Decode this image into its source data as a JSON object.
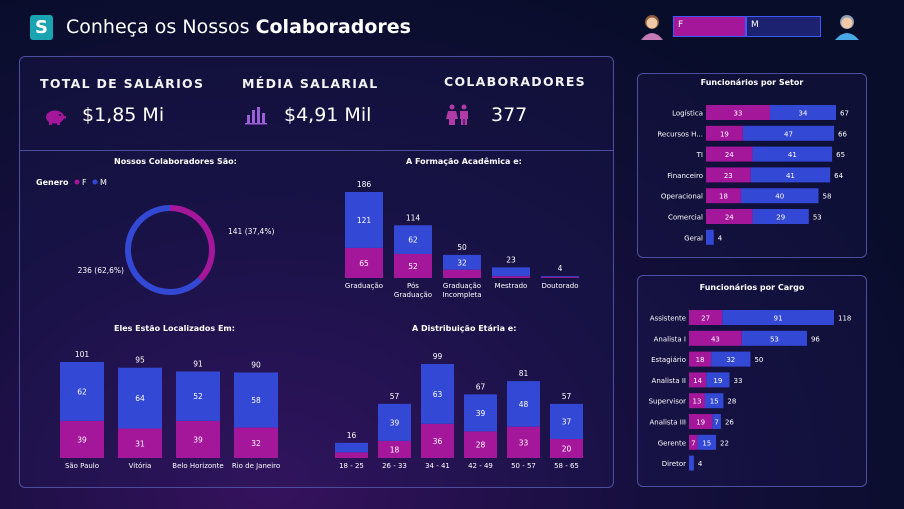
{
  "header": {
    "title_normal": "Conheça os Nossos ",
    "title_bold": "Colaboradores",
    "logo_letter": "S",
    "slicer_f": "F",
    "slicer_m": "M"
  },
  "colors": {
    "female": "#a4169a",
    "male": "#3348d4",
    "panel_border": "#4b4f9e"
  },
  "kpis": [
    {
      "label": "TOTAL DE SALÁRIOS",
      "value": "$1,85 Mi",
      "icon": "piggy-bank-icon"
    },
    {
      "label": "MÉDIA SALARIAL",
      "value": "$4,91 Mil",
      "icon": "bar-chart-icon"
    },
    {
      "label": "COLABORADORES",
      "value": "377",
      "icon": "people-icon"
    }
  ],
  "chart_data": [
    {
      "type": "pie",
      "title": "Nossos Colaboradores São:",
      "legend_title": "Genero",
      "categories": [
        "F",
        "M"
      ],
      "values": [
        141,
        236
      ],
      "labels": [
        "141 (37,4%)",
        "236 (62,6%)"
      ]
    },
    {
      "type": "bar",
      "title": "A Formação Acadêmica e:",
      "categories": [
        "Graduação",
        "Pós Graduação",
        "Graduação Incompleta",
        "Mestrado",
        "Doutorado"
      ],
      "category_lines": [
        [
          "Graduação"
        ],
        [
          "Pós",
          "Graduação"
        ],
        [
          "Graduação",
          "Incompleta"
        ],
        [
          "Mestrado"
        ],
        [
          "Doutorado"
        ]
      ],
      "series": [
        {
          "name": "F",
          "values": [
            65,
            52,
            18,
            4,
            2
          ]
        },
        {
          "name": "M",
          "values": [
            121,
            62,
            32,
            19,
            2
          ]
        }
      ],
      "totals": [
        186,
        114,
        50,
        23,
        4
      ],
      "inner_labels": {
        "F": [
          "65",
          "52",
          "",
          "",
          ""
        ],
        "M": [
          "121",
          "62",
          "32",
          "",
          ""
        ]
      }
    },
    {
      "type": "bar",
      "title": "Eles Estão Localizados Em:",
      "categories": [
        "São Paulo",
        "Vitória",
        "Belo Horizonte",
        "Rio de Janeiro"
      ],
      "series": [
        {
          "name": "F",
          "values": [
            39,
            31,
            39,
            32
          ]
        },
        {
          "name": "M",
          "values": [
            62,
            64,
            52,
            58
          ]
        }
      ],
      "totals": [
        101,
        95,
        91,
        90
      ]
    },
    {
      "type": "bar",
      "title": "A Distribuição Etária e:",
      "categories": [
        "18 - 25",
        "26 - 33",
        "34 - 41",
        "42 - 49",
        "50 - 57",
        "58 - 65"
      ],
      "series": [
        {
          "name": "F",
          "values": [
            6,
            18,
            36,
            28,
            33,
            20
          ]
        },
        {
          "name": "M",
          "values": [
            10,
            39,
            63,
            39,
            48,
            37
          ]
        }
      ],
      "totals": [
        16,
        57,
        99,
        67,
        81,
        57
      ],
      "inner_labels": {
        "F": [
          "",
          "18",
          "36",
          "28",
          "33",
          "20"
        ],
        "M": [
          "",
          "39",
          "63",
          "39",
          "48",
          "37"
        ]
      }
    },
    {
      "type": "bar",
      "orientation": "horizontal",
      "title": "Funcionários por Setor",
      "categories": [
        "Logística",
        "Recursos H...",
        "TI",
        "Financeiro",
        "Operacional",
        "Comercial",
        "Geral"
      ],
      "series": [
        {
          "name": "F",
          "values": [
            33,
            19,
            24,
            23,
            18,
            24,
            0
          ]
        },
        {
          "name": "M",
          "values": [
            34,
            47,
            41,
            41,
            40,
            29,
            4
          ]
        }
      ],
      "totals": [
        67,
        66,
        65,
        64,
        58,
        53,
        4
      ]
    },
    {
      "type": "bar",
      "orientation": "horizontal",
      "title": "Funcionários por Cargo",
      "categories": [
        "Assistente",
        "Analista I",
        "Estagiário",
        "Analista II",
        "Supervisor",
        "Analista III",
        "Gerente",
        "Diretor"
      ],
      "series": [
        {
          "name": "F",
          "values": [
            27,
            43,
            18,
            14,
            13,
            19,
            7,
            0
          ]
        },
        {
          "name": "M",
          "values": [
            91,
            53,
            32,
            19,
            15,
            7,
            15,
            4
          ]
        }
      ],
      "totals": [
        118,
        96,
        50,
        33,
        28,
        26,
        22,
        4
      ],
      "inner_labels": {
        "F": [
          "27",
          "43",
          "18",
          "14",
          "13",
          "19",
          "7",
          ""
        ],
        "M": [
          "91",
          "53",
          "32",
          "19",
          "15",
          "7",
          "15",
          ""
        ]
      }
    }
  ]
}
